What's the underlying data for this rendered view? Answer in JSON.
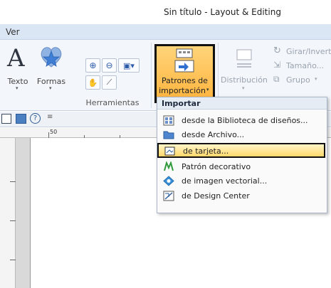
{
  "title": "Sin título - Layout & Editing",
  "menu": {
    "ver": "Ver"
  },
  "ribbon": {
    "texto_label": "Texto",
    "formas_label": "Formas",
    "herramientas_label": "Herramientas",
    "patrones_label_1": "Patrones de",
    "patrones_label_2": "importación",
    "distribucion_label": "Distribución",
    "girar_label": "Girar/Invert",
    "tamano_label": "Tamaño...",
    "grupo_label": "Grupo"
  },
  "ruler": {
    "mark_50": "50"
  },
  "dropdown": {
    "header": "Importar",
    "items": [
      {
        "label": "desde la Biblioteca de diseños...",
        "icon": "library-icon"
      },
      {
        "label": "desde Archivo...",
        "icon": "folder-icon"
      },
      {
        "label": "de tarjeta...",
        "icon": "card-icon"
      },
      {
        "label": "Patrón decorativo",
        "icon": "decorative-pattern-icon"
      },
      {
        "label": "de imagen vectorial...",
        "icon": "vector-image-icon"
      },
      {
        "label": "de Design Center",
        "icon": "design-center-icon"
      }
    ]
  },
  "colors": {
    "highlight": "#ffd86b",
    "menubar": "#dbe6f4",
    "ribbon": "#f3f6fa"
  }
}
